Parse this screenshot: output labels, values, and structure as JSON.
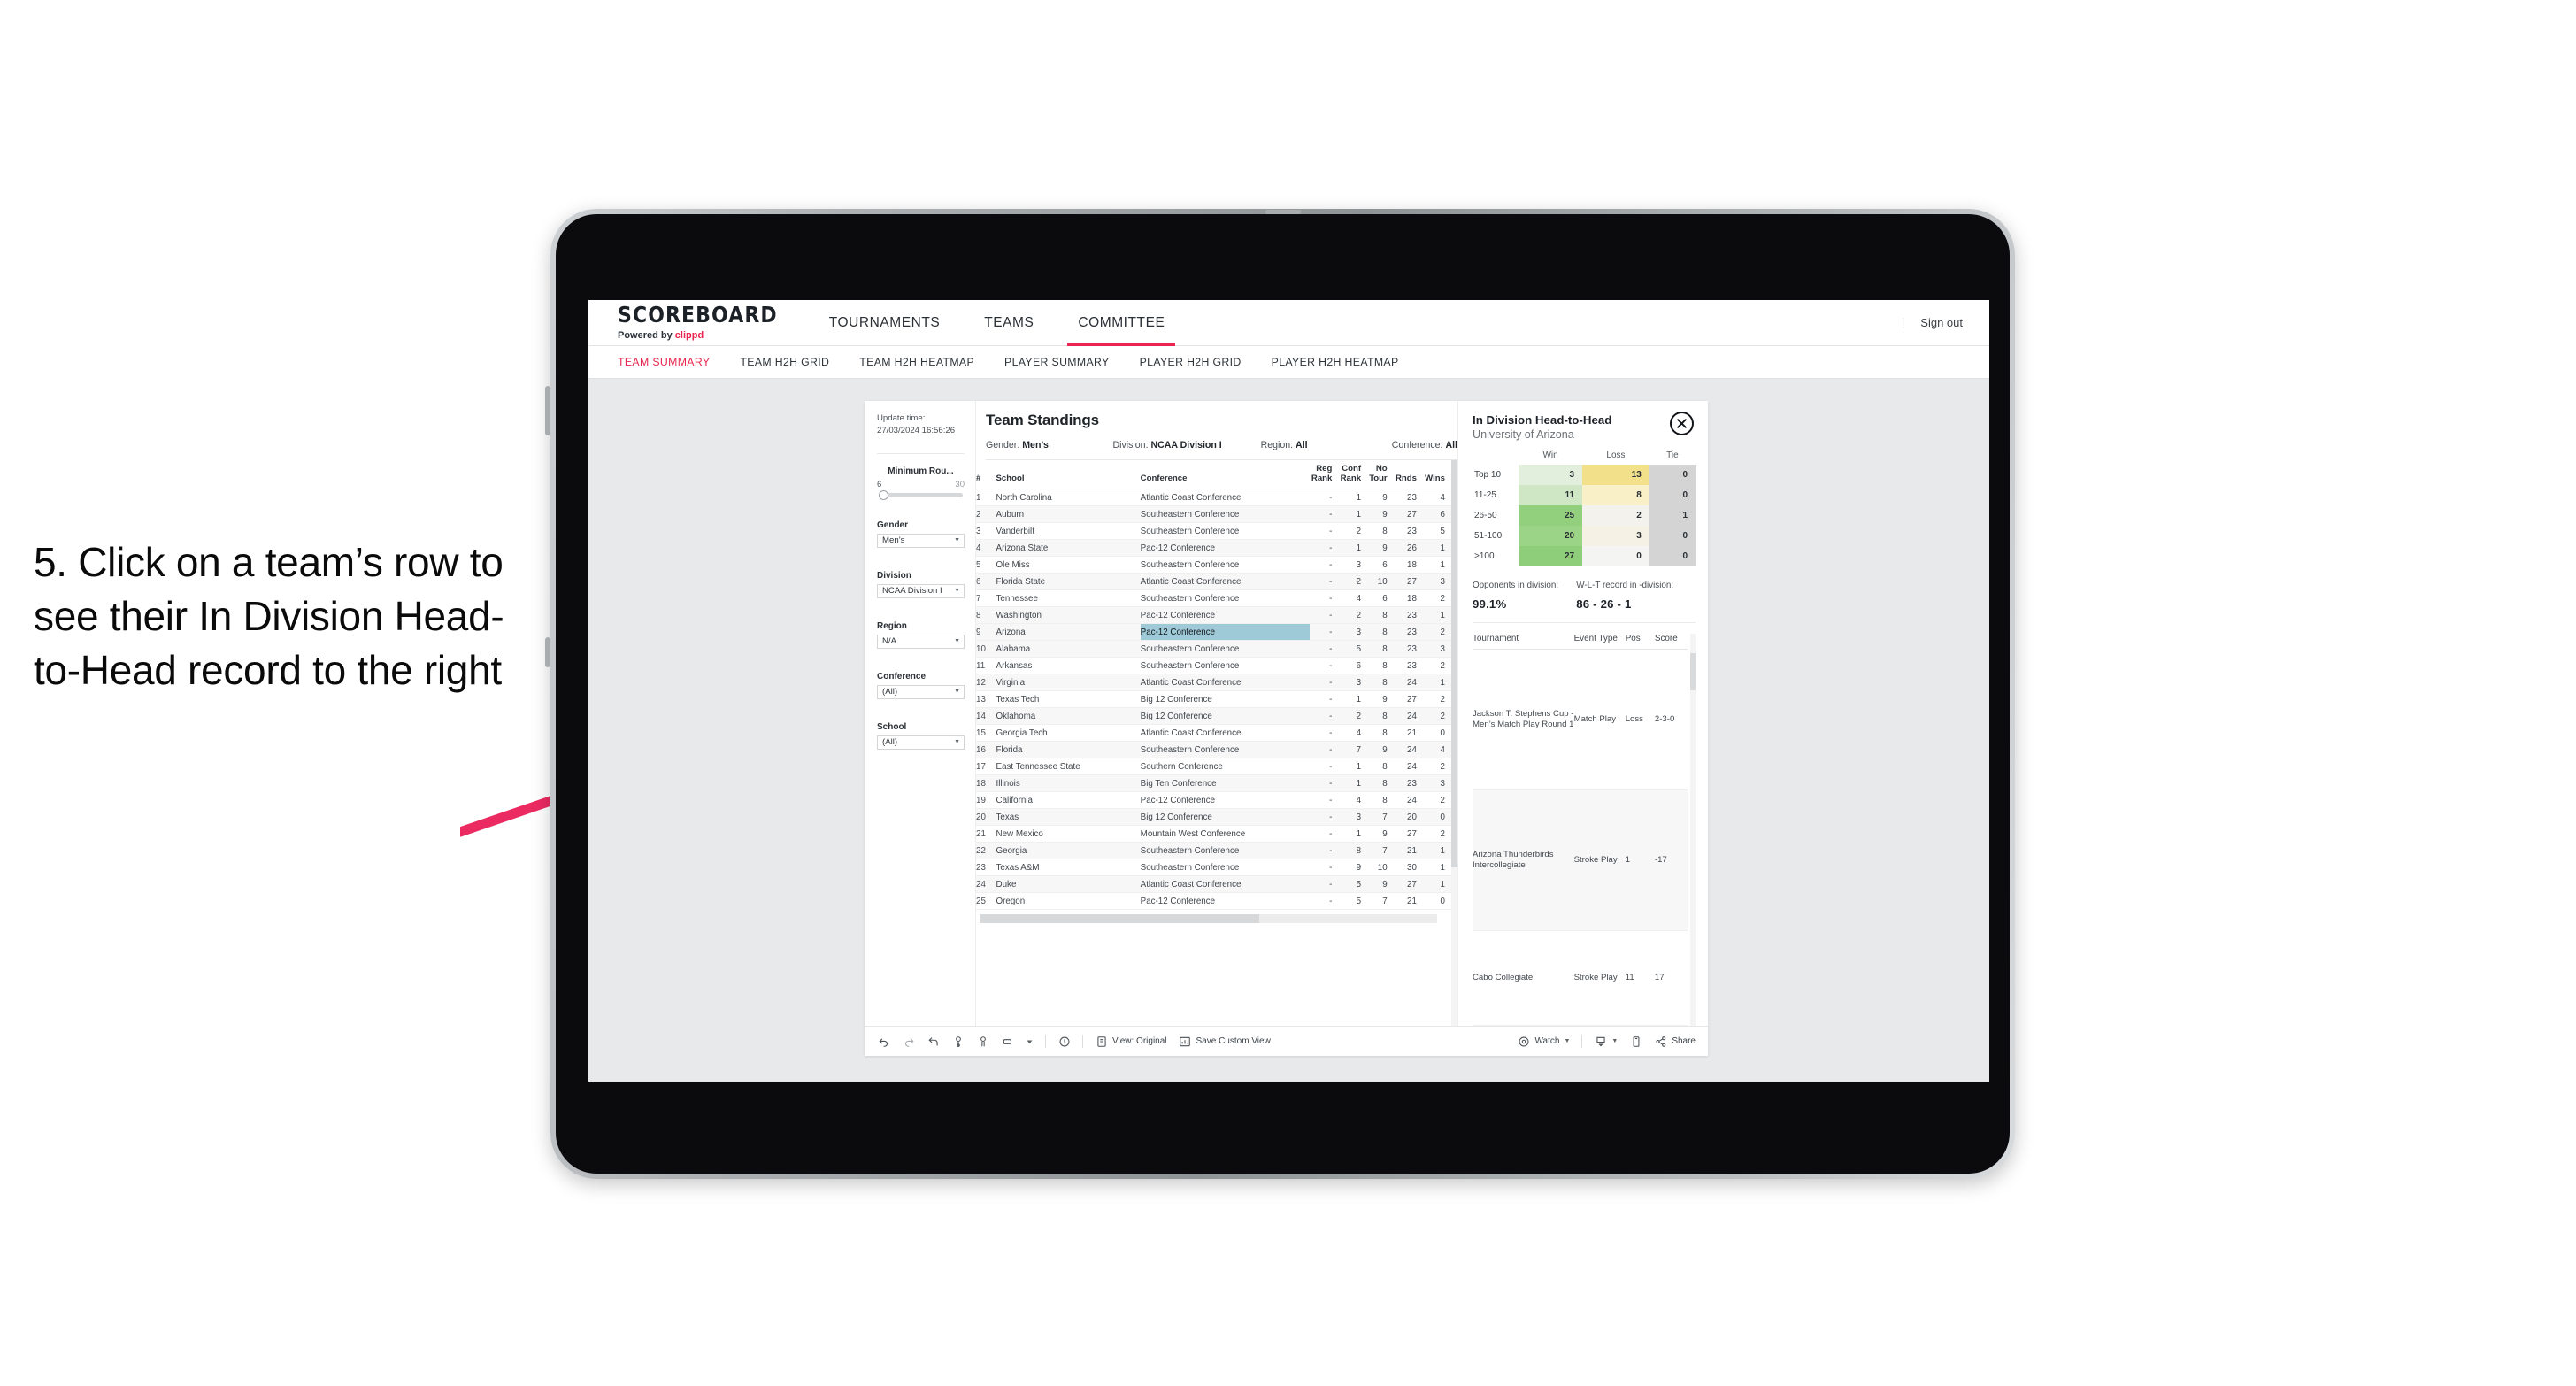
{
  "annotation": {
    "text": "5. Click on a team’s row to see their In Division Head-to-Head record to the right",
    "arrow_color": "#ec2a62"
  },
  "topnav": {
    "brand_title": "SCOREBOARD",
    "brand_sub_prefix": "Powered by ",
    "brand_sub_name": "clippd",
    "items": [
      {
        "label": "TOURNAMENTS",
        "active": false
      },
      {
        "label": "TEAMS",
        "active": false
      },
      {
        "label": "COMMITTEE",
        "active": true
      }
    ],
    "divider": "|",
    "signout": "Sign out",
    "accent": "#e8264f"
  },
  "subnav": {
    "items": [
      {
        "label": "TEAM SUMMARY",
        "active": true
      },
      {
        "label": "TEAM H2H GRID",
        "active": false
      },
      {
        "label": "TEAM H2H HEATMAP",
        "active": false
      },
      {
        "label": "PLAYER SUMMARY",
        "active": false
      },
      {
        "label": "PLAYER H2H GRID",
        "active": false
      },
      {
        "label": "PLAYER H2H HEATMAP",
        "active": false
      }
    ]
  },
  "filters": {
    "update_time_label": "Update time:",
    "update_time_value": "27/03/2024 16:56:26",
    "slider": {
      "label": "Minimum Rou...",
      "min": "6",
      "max": "30"
    },
    "selects": [
      {
        "label": "Gender",
        "value": "Men’s"
      },
      {
        "label": "Division",
        "value": "NCAA Division I"
      },
      {
        "label": "Region",
        "value": "N/A"
      },
      {
        "label": "Conference",
        "value": "(All)"
      },
      {
        "label": "School",
        "value": "(All)"
      }
    ]
  },
  "standings": {
    "title": "Team Standings",
    "filter_summary": [
      {
        "label": "Gender:",
        "value": "Men’s"
      },
      {
        "label": "Division:",
        "value": "NCAA Division I"
      },
      {
        "label": "Region:",
        "value": "All"
      },
      {
        "label": "Conference:",
        "value": "All"
      }
    ],
    "columns": [
      "#",
      "School",
      "Conference",
      "Reg Rank",
      "Conf Rank",
      "No Tour",
      "Rnds",
      "Wins"
    ],
    "rows": [
      {
        "rank": "1",
        "school": "North Carolina",
        "conference": "Atlantic Coast Conference",
        "reg_rank": "-",
        "conf_rank": "1",
        "no_tour": "9",
        "rnds": "23",
        "wins": "4",
        "selected": false
      },
      {
        "rank": "2",
        "school": "Auburn",
        "conference": "Southeastern Conference",
        "reg_rank": "-",
        "conf_rank": "1",
        "no_tour": "9",
        "rnds": "27",
        "wins": "6",
        "selected": false
      },
      {
        "rank": "3",
        "school": "Vanderbilt",
        "conference": "Southeastern Conference",
        "reg_rank": "-",
        "conf_rank": "2",
        "no_tour": "8",
        "rnds": "23",
        "wins": "5",
        "selected": false
      },
      {
        "rank": "4",
        "school": "Arizona State",
        "conference": "Pac-12 Conference",
        "reg_rank": "-",
        "conf_rank": "1",
        "no_tour": "9",
        "rnds": "26",
        "wins": "1",
        "selected": false
      },
      {
        "rank": "5",
        "school": "Ole Miss",
        "conference": "Southeastern Conference",
        "reg_rank": "-",
        "conf_rank": "3",
        "no_tour": "6",
        "rnds": "18",
        "wins": "1",
        "selected": false
      },
      {
        "rank": "6",
        "school": "Florida State",
        "conference": "Atlantic Coast Conference",
        "reg_rank": "-",
        "conf_rank": "2",
        "no_tour": "10",
        "rnds": "27",
        "wins": "3",
        "selected": false
      },
      {
        "rank": "7",
        "school": "Tennessee",
        "conference": "Southeastern Conference",
        "reg_rank": "-",
        "conf_rank": "4",
        "no_tour": "6",
        "rnds": "18",
        "wins": "2",
        "selected": false
      },
      {
        "rank": "8",
        "school": "Washington",
        "conference": "Pac-12 Conference",
        "reg_rank": "-",
        "conf_rank": "2",
        "no_tour": "8",
        "rnds": "23",
        "wins": "1",
        "selected": false
      },
      {
        "rank": "9",
        "school": "Arizona",
        "conference": "Pac-12 Conference",
        "reg_rank": "-",
        "conf_rank": "3",
        "no_tour": "8",
        "rnds": "23",
        "wins": "2",
        "selected": true
      },
      {
        "rank": "10",
        "school": "Alabama",
        "conference": "Southeastern Conference",
        "reg_rank": "-",
        "conf_rank": "5",
        "no_tour": "8",
        "rnds": "23",
        "wins": "3",
        "selected": false
      },
      {
        "rank": "11",
        "school": "Arkansas",
        "conference": "Southeastern Conference",
        "reg_rank": "-",
        "conf_rank": "6",
        "no_tour": "8",
        "rnds": "23",
        "wins": "2",
        "selected": false
      },
      {
        "rank": "12",
        "school": "Virginia",
        "conference": "Atlantic Coast Conference",
        "reg_rank": "-",
        "conf_rank": "3",
        "no_tour": "8",
        "rnds": "24",
        "wins": "1",
        "selected": false
      },
      {
        "rank": "13",
        "school": "Texas Tech",
        "conference": "Big 12 Conference",
        "reg_rank": "-",
        "conf_rank": "1",
        "no_tour": "9",
        "rnds": "27",
        "wins": "2",
        "selected": false
      },
      {
        "rank": "14",
        "school": "Oklahoma",
        "conference": "Big 12 Conference",
        "reg_rank": "-",
        "conf_rank": "2",
        "no_tour": "8",
        "rnds": "24",
        "wins": "2",
        "selected": false
      },
      {
        "rank": "15",
        "school": "Georgia Tech",
        "conference": "Atlantic Coast Conference",
        "reg_rank": "-",
        "conf_rank": "4",
        "no_tour": "8",
        "rnds": "21",
        "wins": "0",
        "selected": false
      },
      {
        "rank": "16",
        "school": "Florida",
        "conference": "Southeastern Conference",
        "reg_rank": "-",
        "conf_rank": "7",
        "no_tour": "9",
        "rnds": "24",
        "wins": "4",
        "selected": false
      },
      {
        "rank": "17",
        "school": "East Tennessee State",
        "conference": "Southern Conference",
        "reg_rank": "-",
        "conf_rank": "1",
        "no_tour": "8",
        "rnds": "24",
        "wins": "2",
        "selected": false
      },
      {
        "rank": "18",
        "school": "Illinois",
        "conference": "Big Ten Conference",
        "reg_rank": "-",
        "conf_rank": "1",
        "no_tour": "8",
        "rnds": "23",
        "wins": "3",
        "selected": false
      },
      {
        "rank": "19",
        "school": "California",
        "conference": "Pac-12 Conference",
        "reg_rank": "-",
        "conf_rank": "4",
        "no_tour": "8",
        "rnds": "24",
        "wins": "2",
        "selected": false
      },
      {
        "rank": "20",
        "school": "Texas",
        "conference": "Big 12 Conference",
        "reg_rank": "-",
        "conf_rank": "3",
        "no_tour": "7",
        "rnds": "20",
        "wins": "0",
        "selected": false
      },
      {
        "rank": "21",
        "school": "New Mexico",
        "conference": "Mountain West Conference",
        "reg_rank": "-",
        "conf_rank": "1",
        "no_tour": "9",
        "rnds": "27",
        "wins": "2",
        "selected": false
      },
      {
        "rank": "22",
        "school": "Georgia",
        "conference": "Southeastern Conference",
        "reg_rank": "-",
        "conf_rank": "8",
        "no_tour": "7",
        "rnds": "21",
        "wins": "1",
        "selected": false
      },
      {
        "rank": "23",
        "school": "Texas A&M",
        "conference": "Southeastern Conference",
        "reg_rank": "-",
        "conf_rank": "9",
        "no_tour": "10",
        "rnds": "30",
        "wins": "1",
        "selected": false
      },
      {
        "rank": "24",
        "school": "Duke",
        "conference": "Atlantic Coast Conference",
        "reg_rank": "-",
        "conf_rank": "5",
        "no_tour": "9",
        "rnds": "27",
        "wins": "1",
        "selected": false
      },
      {
        "rank": "25",
        "school": "Oregon",
        "conference": "Pac-12 Conference",
        "reg_rank": "-",
        "conf_rank": "5",
        "no_tour": "7",
        "rnds": "21",
        "wins": "0",
        "selected": false
      }
    ],
    "selected_highlight_color": "#9ecad8"
  },
  "h2h": {
    "title": "In Division Head-to-Head",
    "subtitle": "University of Arizona",
    "close_icon": "close-icon",
    "matrix_columns": [
      "Win",
      "Loss",
      "Tie"
    ],
    "matrix_rows": [
      {
        "label": "Top 10",
        "win": "3",
        "loss": "13",
        "tie": "0",
        "win_color": "#e1efdc",
        "loss_color": "#f2e08a",
        "tie_color": "#d4d4d4"
      },
      {
        "label": "11-25",
        "win": "11",
        "loss": "8",
        "tie": "0",
        "win_color": "#cfe7c4",
        "loss_color": "#faf0c8",
        "tie_color": "#d4d4d4"
      },
      {
        "label": "26-50",
        "win": "25",
        "loss": "2",
        "tie": "1",
        "win_color": "#92d07e",
        "loss_color": "#f3f2ec",
        "tie_color": "#d4d4d4"
      },
      {
        "label": "51-100",
        "win": "20",
        "loss": "3",
        "tie": "0",
        "win_color": "#9bd487",
        "loss_color": "#f5f1e4",
        "tie_color": "#d4d4d4"
      },
      {
        "label": ">100",
        "win": "27",
        "loss": "0",
        "tie": "0",
        "win_color": "#8ecd7a",
        "loss_color": "#f4f4f2",
        "tie_color": "#d4d4d4"
      }
    ],
    "stats": [
      {
        "label": "Opponents in division:",
        "value": "99.1%"
      },
      {
        "label": "W-L-T record in -division:",
        "value": "86 - 26 - 1"
      }
    ],
    "tournament_columns": [
      "Tournament",
      "Event Type",
      "Pos",
      "Score"
    ],
    "tournaments": [
      {
        "name": "Jackson T. Stephens Cup - Men’s Match Play Round 1",
        "event_type": "Match Play",
        "pos": "Loss",
        "score": "2-3-0"
      },
      {
        "name": "Arizona Thunderbirds Intercollegiate",
        "event_type": "Stroke Play",
        "pos": "1",
        "score": "-17"
      },
      {
        "name": "Cabo Collegiate",
        "event_type": "Stroke Play",
        "pos": "11",
        "score": "17"
      }
    ]
  },
  "toolbar": {
    "icons": [
      "undo-icon",
      "redo-icon",
      "revert-icon",
      "refresh-icon",
      "pause-icon",
      "highlight-icon",
      "caret-down-icon"
    ],
    "clock_icon": "clock-icon",
    "view_label": "View: Original",
    "view_icon": "view-icon",
    "save_view_label": "Save Custom View",
    "save_view_icon": "save-view-icon",
    "watch_label": "Watch",
    "watch_icon": "watch-icon",
    "watch_caret": "caret-down-icon",
    "download_icon": "download-icon",
    "download_caret": "caret-down-icon",
    "device_icon": "device-layout-icon",
    "share_label": "Share",
    "share_icon": "share-icon"
  }
}
